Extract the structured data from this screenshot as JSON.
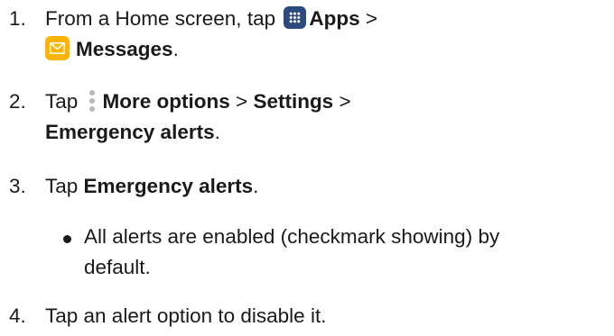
{
  "steps": [
    {
      "number": "1.",
      "line1_prefix": "From a Home screen, tap ",
      "apps_label": "Apps",
      "sep1": " >",
      "messages_label": "Messages",
      "end": "."
    },
    {
      "number": "2.",
      "prefix": "Tap ",
      "more_options_label": "More options",
      "sep1": " > ",
      "settings_label": "Settings",
      "sep2": " >",
      "emergency_alerts_label": "Emergency alerts",
      "end": "."
    },
    {
      "number": "3.",
      "prefix": "Tap ",
      "emergency_alerts_label": "Emergency alerts",
      "end": "."
    },
    {
      "number": "4.",
      "text": "Tap an alert option to disable it."
    }
  ],
  "bullet": {
    "line1": "All alerts are enabled (checkmark showing) by",
    "line2": "default."
  },
  "icons": {
    "apps": "apps-grid-icon",
    "messages": "messages-envelope-icon",
    "more_options": "more-options-vertical-dots-icon"
  },
  "colors": {
    "apps_icon_bg": "#2d4a7f",
    "messages_icon_bg": "#ffb400",
    "more_options_dots": "#b8b8b8",
    "text": "#1a1a1a"
  }
}
